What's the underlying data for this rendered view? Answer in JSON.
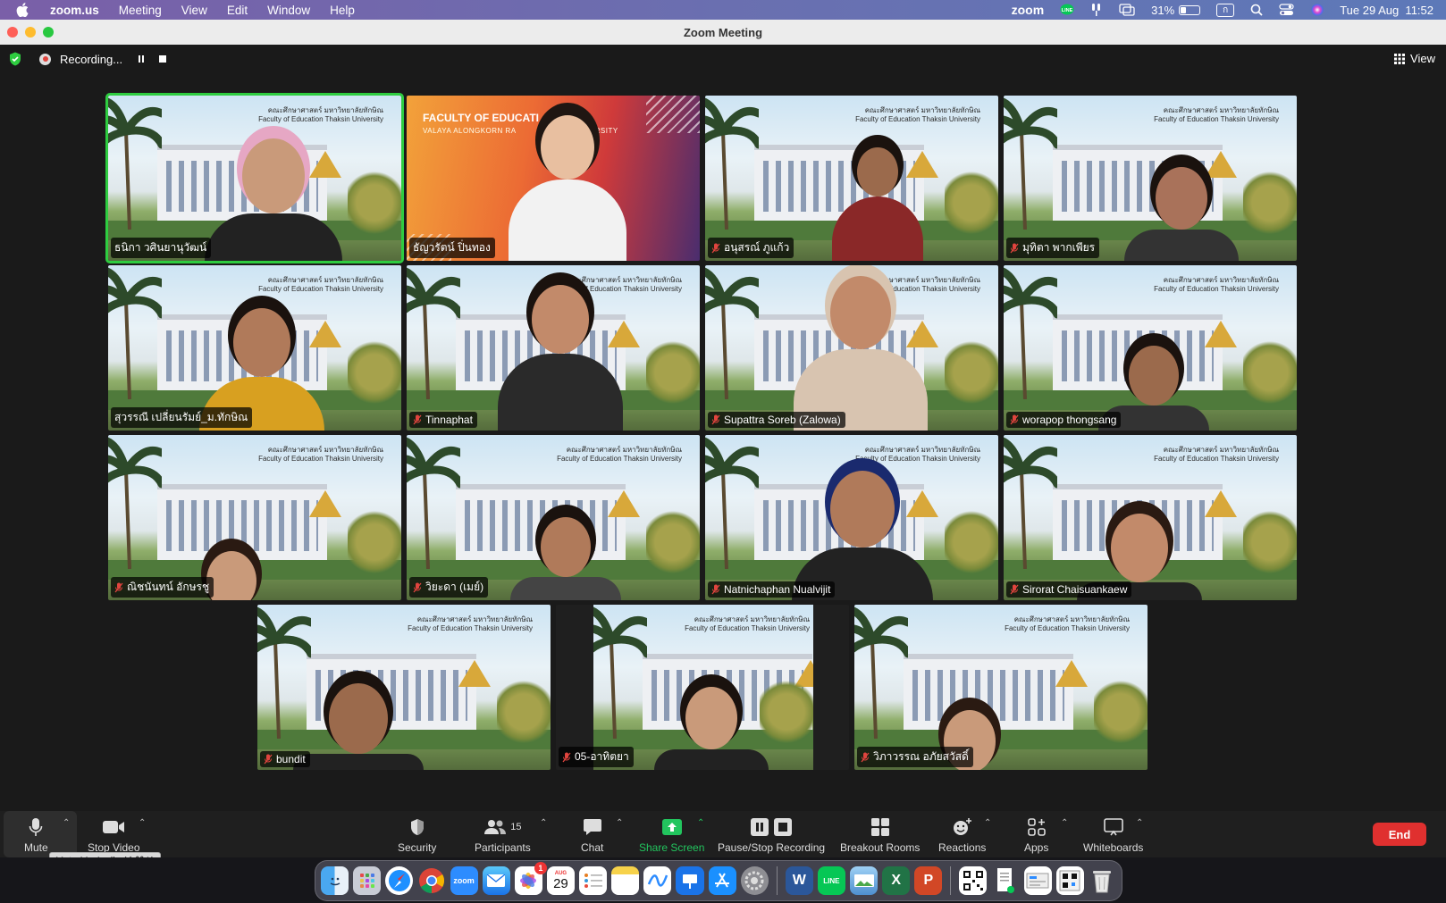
{
  "menubar": {
    "app_name": "zoom.us",
    "menus": [
      "Meeting",
      "View",
      "Edit",
      "Window",
      "Help"
    ],
    "zoom_label": "zoom",
    "battery_percent": "31%",
    "battery_level": 0.31,
    "input_source": "ก",
    "clock": "Tue 29 Aug  11:52"
  },
  "window": {
    "title": "Zoom Meeting"
  },
  "meeting_header": {
    "recording_label": "Recording...",
    "view_label": "View"
  },
  "tile_logo": {
    "line1": "คณะศึกษาศาสตร์ มหาวิทยาลัยทักษิณ",
    "line2": "Faculty of Education Thaksin University"
  },
  "branded_bg": {
    "line1": "FACULTY OF EDUCATI",
    "line2": "VALAYA ALONGKORN RA",
    "line2_tail": "RSITY"
  },
  "participants": [
    {
      "name": "ธนิกา วศินยานุวัฒน์",
      "muted": false,
      "active_speaker": true
    },
    {
      "name": "ธัญวรัตน์ ปิ่นทอง",
      "muted": false,
      "active_speaker": false
    },
    {
      "name": "อนุสรณ์ ภูแก้ว",
      "muted": true,
      "active_speaker": false
    },
    {
      "name": "มุทิตา พากเพียร",
      "muted": true,
      "active_speaker": false
    },
    {
      "name": "สุวรรณี เปลี่ยนรัมย์_ม.ทักษิณ",
      "muted": false,
      "active_speaker": false
    },
    {
      "name": "Tinnaphat",
      "muted": true,
      "active_speaker": false
    },
    {
      "name": "Supattra Soreb (Zalowa)",
      "muted": true,
      "active_speaker": false
    },
    {
      "name": "worapop thongsang",
      "muted": true,
      "active_speaker": false
    },
    {
      "name": "ณิชนันทน์ อักษรชู",
      "muted": true,
      "active_speaker": false
    },
    {
      "name": "วิยะดา (เมย์)",
      "muted": true,
      "active_speaker": false
    },
    {
      "name": "Natnichaphan Nualvijit",
      "muted": true,
      "active_speaker": false
    },
    {
      "name": "Sirorat Chaisuankaew",
      "muted": true,
      "active_speaker": false
    },
    {
      "name": "bundit",
      "muted": true,
      "active_speaker": false
    },
    {
      "name": "05-อาทิตยา",
      "muted": true,
      "active_speaker": false
    },
    {
      "name": "วิภาวรรณ อภัยสวัสดิ์",
      "muted": true,
      "active_speaker": false
    }
  ],
  "toolbar": {
    "mute": "Mute",
    "stop_video": "Stop Video",
    "security": "Security",
    "participants": "Participants",
    "participants_count": "15",
    "chat": "Chat",
    "share_screen": "Share Screen",
    "pause_stop_recording": "Pause/Stop Recording",
    "breakout_rooms": "Breakout Rooms",
    "reactions": "Reactions",
    "apps": "Apps",
    "whiteboards": "Whiteboards",
    "end": "End"
  },
  "tooltip": {
    "mute_shortcut": "Mute My Audio (⇧⌘A)"
  },
  "dock": {
    "zoom_label": "zoom",
    "calendar_month": "AUG",
    "calendar_day": "29",
    "photos_badge": "1",
    "word_label": "W",
    "excel_label": "X",
    "powerpoint_label": "P",
    "line_label": "LINE"
  },
  "colors": {
    "active_speaker_border": "#2ecc40",
    "end_button": "#e0302f",
    "share_screen_green": "#22c55e",
    "muted_mic": "#e0443e"
  }
}
